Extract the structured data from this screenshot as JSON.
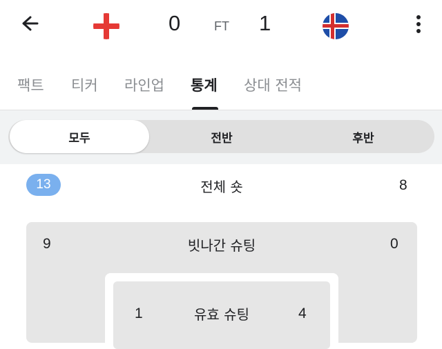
{
  "match": {
    "home_team_flag": "england-flag",
    "away_team_flag": "iceland-flag",
    "home_score": "0",
    "away_score": "1",
    "status": "FT"
  },
  "tabs": [
    {
      "label": "팩트"
    },
    {
      "label": "티커"
    },
    {
      "label": "라인업"
    },
    {
      "label": "통계",
      "active": true
    },
    {
      "label": "상대 전적"
    }
  ],
  "period_filter": {
    "options": [
      "모두",
      "전반",
      "후반"
    ],
    "selected": "모두"
  },
  "stats": {
    "total_shots": {
      "label": "전체 숏",
      "home": "13",
      "away": "8"
    },
    "shots_off_target": {
      "label": "빗나간 슈팅",
      "home": "9",
      "away": "0"
    },
    "shots_on_target": {
      "label": "유효 슈팅",
      "home": "1",
      "away": "4"
    }
  },
  "colors": {
    "accent_badge": "#7ab0ee",
    "england_red": "#e53935",
    "iceland_blue": "#1e4ea8",
    "iceland_red": "#d32f2f"
  }
}
